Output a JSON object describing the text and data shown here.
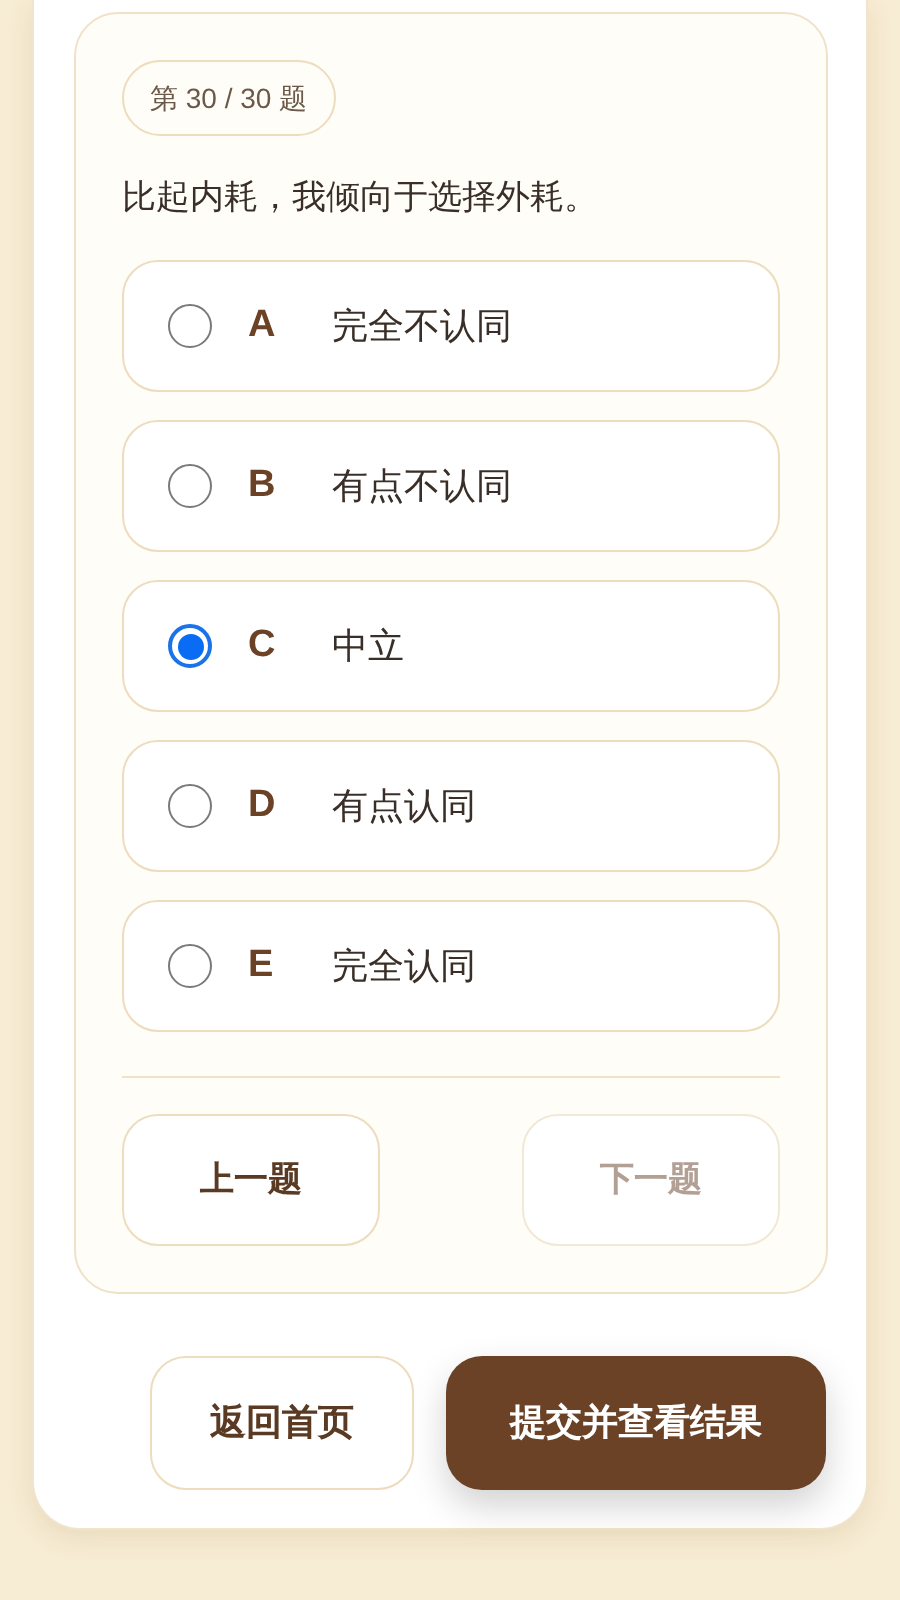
{
  "progress_badge": "第 30 / 30 题",
  "question": "比起内耗，我倾向于选择外耗。",
  "options": [
    {
      "letter": "A",
      "label": "完全不认同",
      "selected": false
    },
    {
      "letter": "B",
      "label": "有点不认同",
      "selected": false
    },
    {
      "letter": "C",
      "label": "中立",
      "selected": true
    },
    {
      "letter": "D",
      "label": "有点认同",
      "selected": false
    },
    {
      "letter": "E",
      "label": "完全认同",
      "selected": false
    }
  ],
  "nav_buttons": [
    {
      "label": "上一题",
      "disabled": false
    },
    {
      "label": "下一题",
      "disabled": true
    }
  ],
  "footer_buttons": [
    {
      "label": "返回首页",
      "kind": "secondary"
    },
    {
      "label": "提交并查看结果",
      "kind": "primary"
    }
  ]
}
